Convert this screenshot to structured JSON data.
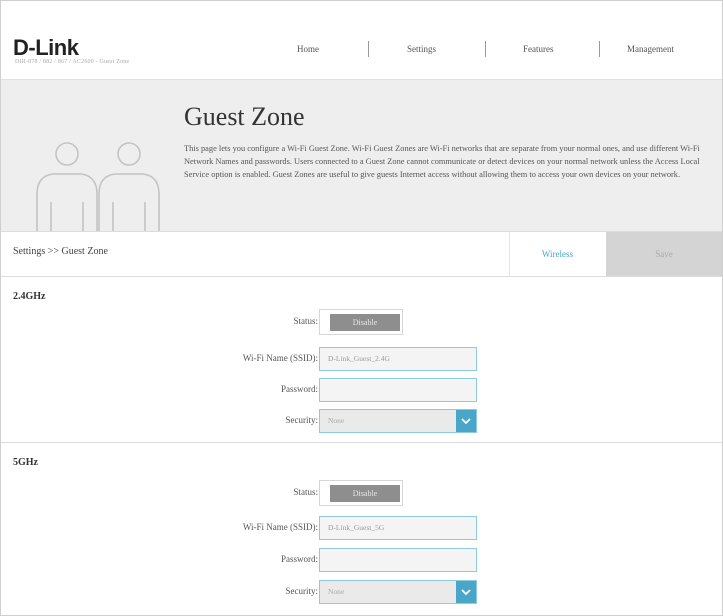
{
  "header": {
    "logo": "D-Link",
    "model": "DIR-878 / 882 / 867 / AC2600 - Guest Zone",
    "nav": [
      "Home",
      "Settings",
      "Features",
      "Management"
    ]
  },
  "banner": {
    "title": "Guest Zone",
    "description": "This page lets you configure a Wi-Fi Guest Zone. Wi-Fi Guest Zones are Wi-Fi networks that are separate from your normal ones, and use different Wi-Fi Network Names and passwords. Users connected to a Guest Zone cannot communicate or detect devices on your normal network unless the Access Local Service option is enabled. Guest Zones are useful to give guests Internet access without allowing them to access your own devices on your network."
  },
  "breadcrumb": "Settings >> Guest Zone",
  "actions": {
    "wireless": "Wireless",
    "save": "Save"
  },
  "labels": {
    "status": "Status:",
    "ssid": "Wi-Fi Name (SSID):",
    "password": "Password:",
    "security": "Security:"
  },
  "band_24": {
    "title": "2.4GHz",
    "status": "Disable",
    "ssid": "D-Link_Guest_2.4G",
    "password": "",
    "security": "None"
  },
  "band_5": {
    "title": "5GHz",
    "status": "Disable",
    "ssid": "D-Link_Guest_5G",
    "password": "",
    "security": "None"
  },
  "colors": {
    "accent": "#4aa6c9",
    "toggle": "#8e8e8e",
    "banner_bg": "#eeeeee"
  }
}
